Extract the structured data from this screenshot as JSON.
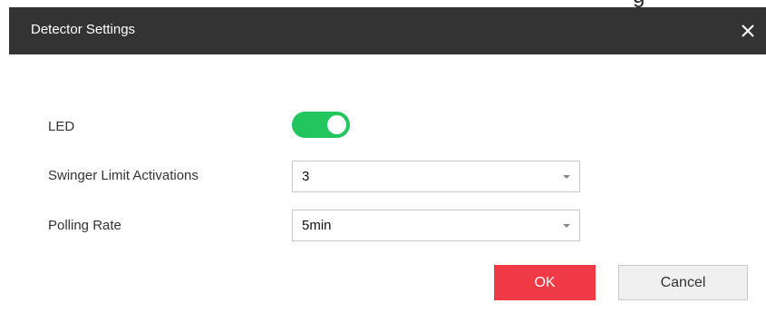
{
  "dialog": {
    "partial_top_text": "g",
    "title": "Detector Settings",
    "close_icon": "close-icon"
  },
  "fields": {
    "led_label": "LED",
    "led_on": true,
    "swinger_label": "Swinger Limit Activations",
    "swinger_value": "3",
    "polling_label": "Polling Rate",
    "polling_value": "5min"
  },
  "buttons": {
    "ok_label": "OK",
    "cancel_label": "Cancel"
  },
  "colors": {
    "header_bg": "#333333",
    "toggle_on": "#22c55e",
    "ok_bg": "#f03a45"
  }
}
